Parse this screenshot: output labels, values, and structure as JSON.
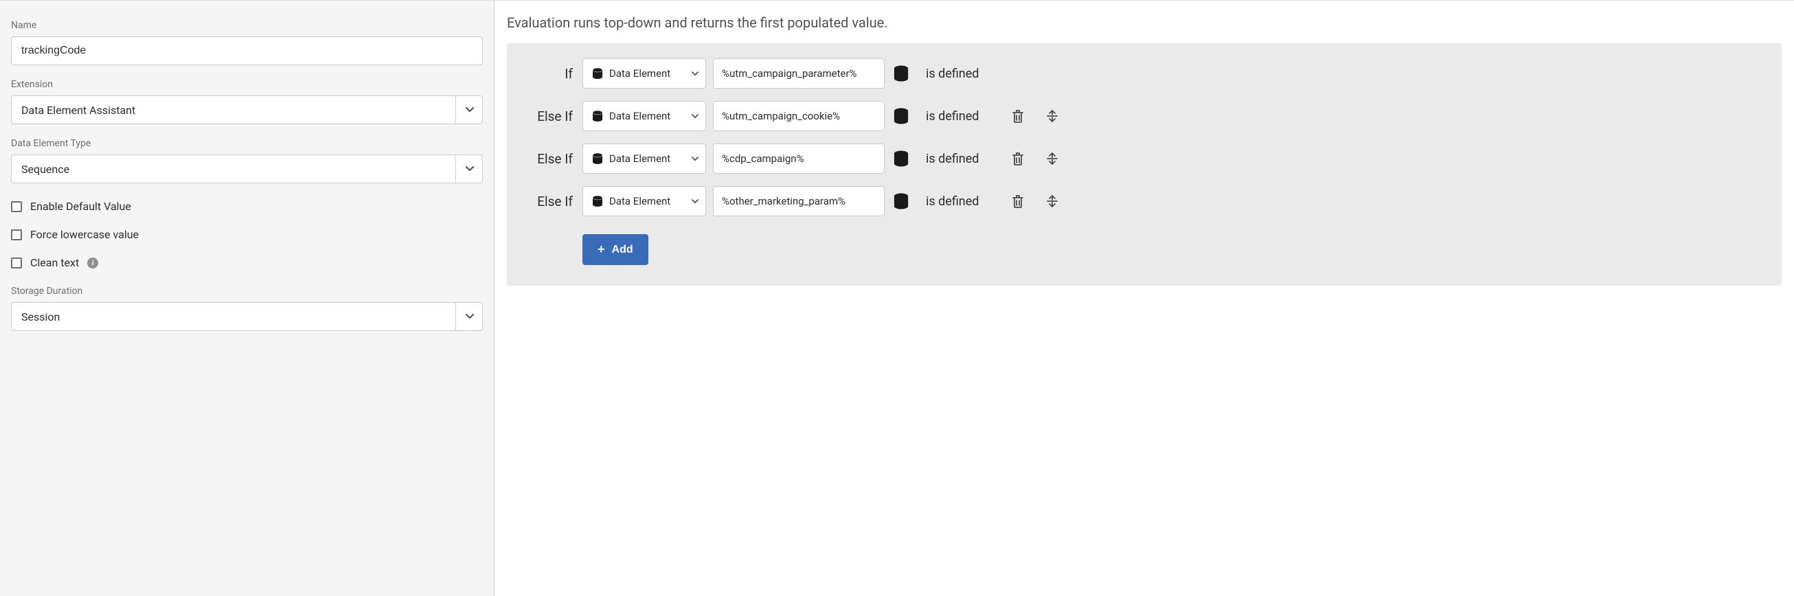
{
  "left": {
    "name_label": "Name",
    "name_value": "trackingCode",
    "extension_label": "Extension",
    "extension_value": "Data Element Assistant",
    "type_label": "Data Element Type",
    "type_value": "Sequence",
    "checkboxes": {
      "enable_default": "Enable Default Value",
      "force_lowercase": "Force lowercase value",
      "clean_text": "Clean text"
    },
    "storage_label": "Storage Duration",
    "storage_value": "Session"
  },
  "right": {
    "heading": "Evaluation runs top-down and returns the first populated value.",
    "rules": [
      {
        "keyword": "If",
        "source": "Data Element",
        "value": "%utm_campaign_parameter%",
        "condition": "is defined",
        "deletable": false
      },
      {
        "keyword": "Else If",
        "source": "Data Element",
        "value": "%utm_campaign_cookie%",
        "condition": "is defined",
        "deletable": true
      },
      {
        "keyword": "Else If",
        "source": "Data Element",
        "value": "%cdp_campaign%",
        "condition": "is defined",
        "deletable": true
      },
      {
        "keyword": "Else If",
        "source": "Data Element",
        "value": "%other_marketing_param%",
        "condition": "is defined",
        "deletable": true
      }
    ],
    "add_label": "Add"
  }
}
